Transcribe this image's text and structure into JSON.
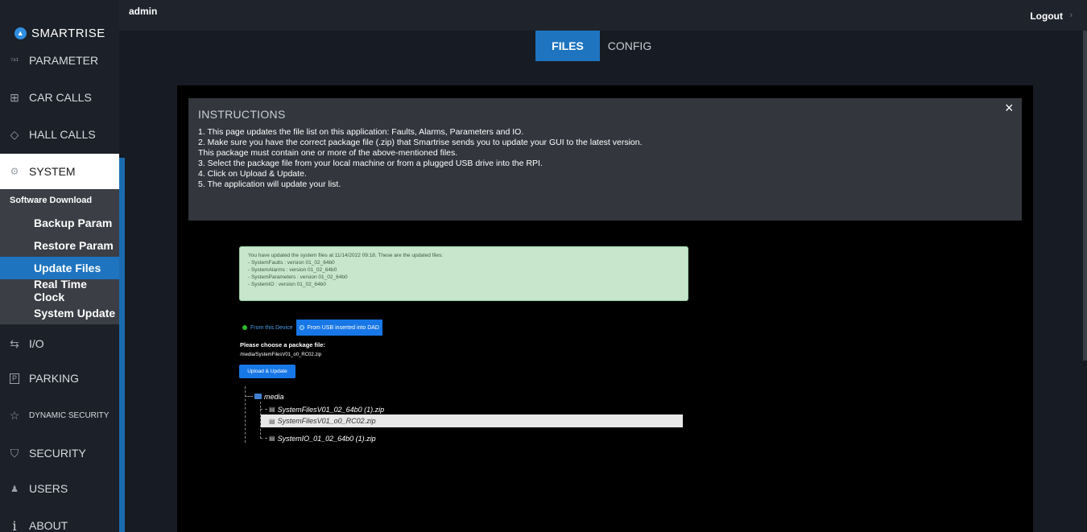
{
  "app": {
    "brand": "SMARTRISE",
    "user": "admin",
    "logout": "Logout"
  },
  "sidebar": {
    "items": [
      {
        "label": "PARAMETER",
        "icon": "parameter-icon",
        "glyph": "⁷⁶¹"
      },
      {
        "label": "CAR CALLS",
        "icon": "car-calls-icon",
        "glyph": "⊞"
      },
      {
        "label": "HALL CALLS",
        "icon": "hall-calls-icon",
        "glyph": "◇"
      },
      {
        "label": "SYSTEM",
        "icon": "gear-icon",
        "glyph": "⚙"
      },
      {
        "label": "I/O",
        "icon": "io-arrows-icon",
        "glyph": "⇆"
      },
      {
        "label": "PARKING",
        "icon": "parking-icon",
        "glyph": "P"
      },
      {
        "label": "DYNAMIC SECURITY",
        "icon": "star-icon",
        "glyph": "☆"
      },
      {
        "label": "SECURITY",
        "icon": "shield-icon",
        "glyph": "⛉"
      },
      {
        "label": "USERS",
        "icon": "users-icon",
        "glyph": "👥"
      },
      {
        "label": "ABOUT",
        "icon": "info-icon",
        "glyph": "i"
      }
    ],
    "system_submenu": [
      "Software Download",
      "Backup Param",
      "Restore Param",
      "Update Files",
      "Real Time Clock",
      "System Update"
    ],
    "active_item": "SYSTEM",
    "selected_submenu": "Update Files"
  },
  "tabs": [
    {
      "label": "FILES",
      "active": true
    },
    {
      "label": "CONFIG",
      "active": false
    }
  ],
  "instructions": {
    "heading": "INSTRUCTIONS",
    "lines": [
      "1. This page updates the file list on this application: Faults, Alarms, Parameters and IO.",
      "2. Make sure you have the correct package file (.zip) that Smartrise sends you to update your GUI to the latest version.",
      "This package must contain one or more of the above-mentioned files.",
      "3. Select the package file from your local machine or from a plugged USB drive into the RPI.",
      "4. Click on Upload & Update.",
      "5. The application will update your list."
    ],
    "close": "×"
  },
  "success_message": {
    "lines": [
      "You have updated the system files at 11/14/2022 09:18. These are the updated files:",
      "- SystemFaults : version 01_02_64b0",
      "- SystemAlarms : version 01_02_64b0",
      "- SystemParameters : version 01_02_64b0",
      "- SystemIO : version 01_02_64b0"
    ]
  },
  "source": {
    "options": [
      {
        "label": "From this Device",
        "selected": false
      },
      {
        "label": "From USB inserted into DAD",
        "selected": true
      }
    ]
  },
  "chooser": {
    "label": "Please choose a package file:",
    "path": "/media/SystemFilesV01_o0_RC02.zip",
    "upload_button": "Upload & Update"
  },
  "tree": {
    "root": "media",
    "files": [
      {
        "name": "SystemFilesV01_02_64b0 (1).zip",
        "selected": false
      },
      {
        "name": "SystemFilesV01_o0_RC02.zip",
        "selected": true
      },
      {
        "name": "SystemIO_01_02_64b0 (1).zip",
        "selected": false
      }
    ]
  },
  "colors": {
    "accent": "#1e74bf",
    "button_blue": "#1877e6",
    "success_bg": "#c7e6cc"
  }
}
